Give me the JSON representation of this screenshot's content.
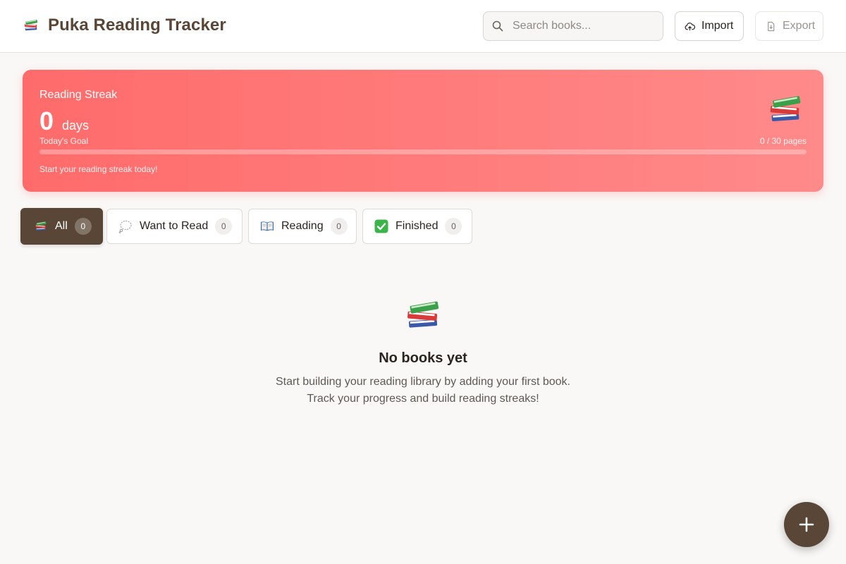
{
  "app": {
    "title": "Puka Reading Tracker",
    "brand_icon": "books-icon"
  },
  "header": {
    "search_placeholder": "Search books...",
    "import_label": "Import",
    "export_label": "Export"
  },
  "streak": {
    "label": "Reading Streak",
    "count": "0",
    "unit": "days",
    "goal_label": "Today's Goal",
    "goal_value": "0 / 30 pages",
    "progress_fraction": 0,
    "hint": "Start your reading streak today!"
  },
  "tabs": [
    {
      "label": "All",
      "count": "0",
      "icon": "books-icon",
      "active": true
    },
    {
      "label": "Want to Read",
      "count": "0",
      "icon": "thought-bubble-icon",
      "active": false
    },
    {
      "label": "Reading",
      "count": "0",
      "icon": "open-book-icon",
      "active": false
    },
    {
      "label": "Finished",
      "count": "0",
      "icon": "check-icon",
      "active": false
    }
  ],
  "empty_state": {
    "title": "No books yet",
    "line1": "Start building your reading library by adding your first book.",
    "line2": "Track your progress and build reading streaks!"
  },
  "colors": {
    "brand": "#5a4636",
    "streak_start": "#ff6b6b",
    "streak_end": "#ff8a8a",
    "background": "#f9f8f7"
  }
}
